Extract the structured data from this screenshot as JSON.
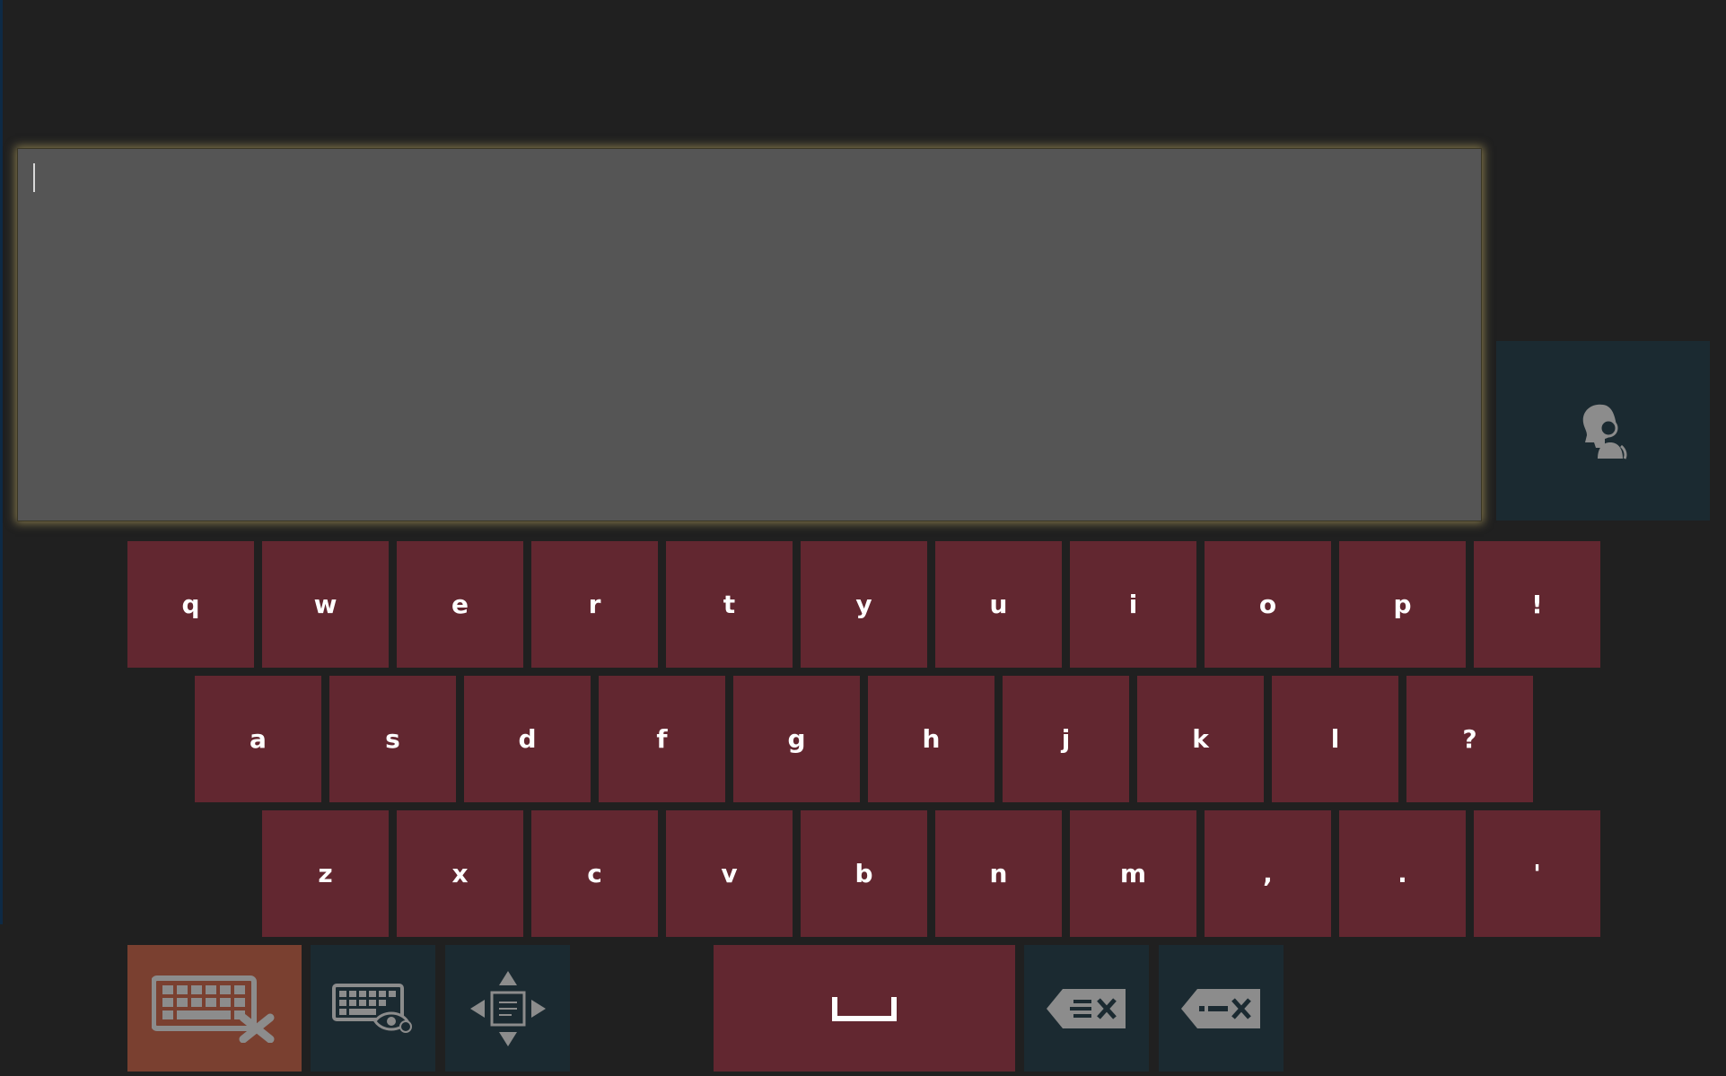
{
  "text_input": {
    "value": "",
    "placeholder": ""
  },
  "keyboard": {
    "row1": [
      "q",
      "w",
      "e",
      "r",
      "t",
      "y",
      "u",
      "i",
      "o",
      "p",
      "!"
    ],
    "row2": [
      "a",
      "s",
      "d",
      "f",
      "g",
      "h",
      "j",
      "k",
      "l",
      "?"
    ],
    "row3": [
      "z",
      "x",
      "c",
      "v",
      "b",
      "n",
      "m",
      ",",
      ".",
      "'"
    ]
  },
  "icons": {
    "speak": "speaking-head-icon",
    "hide_keyboard": "keyboard-close-icon",
    "keyboard_view": "keyboard-eye-icon",
    "move": "four-way-arrows-icon",
    "space": "space-bar-icon",
    "delete_word": "backspace-word-icon",
    "delete_char": "backspace-char-icon"
  },
  "colors": {
    "background": "#202020",
    "key": "#622730",
    "function_key": "#1b2a31",
    "hide_key": "#7a4030",
    "text_area": "#555555",
    "icon": "#8c8c8c"
  }
}
